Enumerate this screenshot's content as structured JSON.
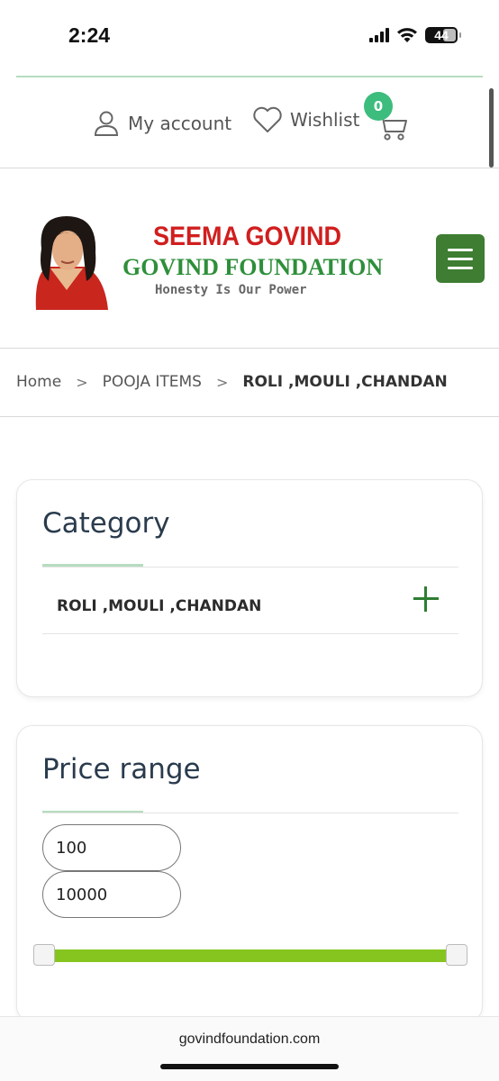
{
  "status_bar": {
    "time": "2:24",
    "battery": "44",
    "icons": [
      "signal-icon",
      "wifi-icon",
      "battery-icon"
    ]
  },
  "header": {
    "account_label": "My account",
    "wishlist_label": "Wishlist",
    "cart_count": "0",
    "icons": [
      "user-icon",
      "heart-icon",
      "cart-icon"
    ],
    "accent_color": "#3cbc7d"
  },
  "logo": {
    "title": "SEEMA GOVIND",
    "subtitle": "GOVIND FOUNDATION",
    "tagline": "Honesty Is Our Power"
  },
  "menu": {
    "icon": "hamburger-menu-icon",
    "color": "#3e7d32"
  },
  "breadcrumb": {
    "items": [
      "Home",
      "POOJA ITEMS",
      "ROLI ,MOULI ,CHANDAN"
    ],
    "separator": ">"
  },
  "category": {
    "title": "Category",
    "items": [
      "ROLI ,MOULI ,CHANDAN"
    ],
    "expand_icon": "plus-icon"
  },
  "price_range": {
    "title": "Price range",
    "min": "100",
    "max": "10000",
    "slider_color": "#86c51f"
  },
  "browser": {
    "url": "govindfoundation.com"
  }
}
